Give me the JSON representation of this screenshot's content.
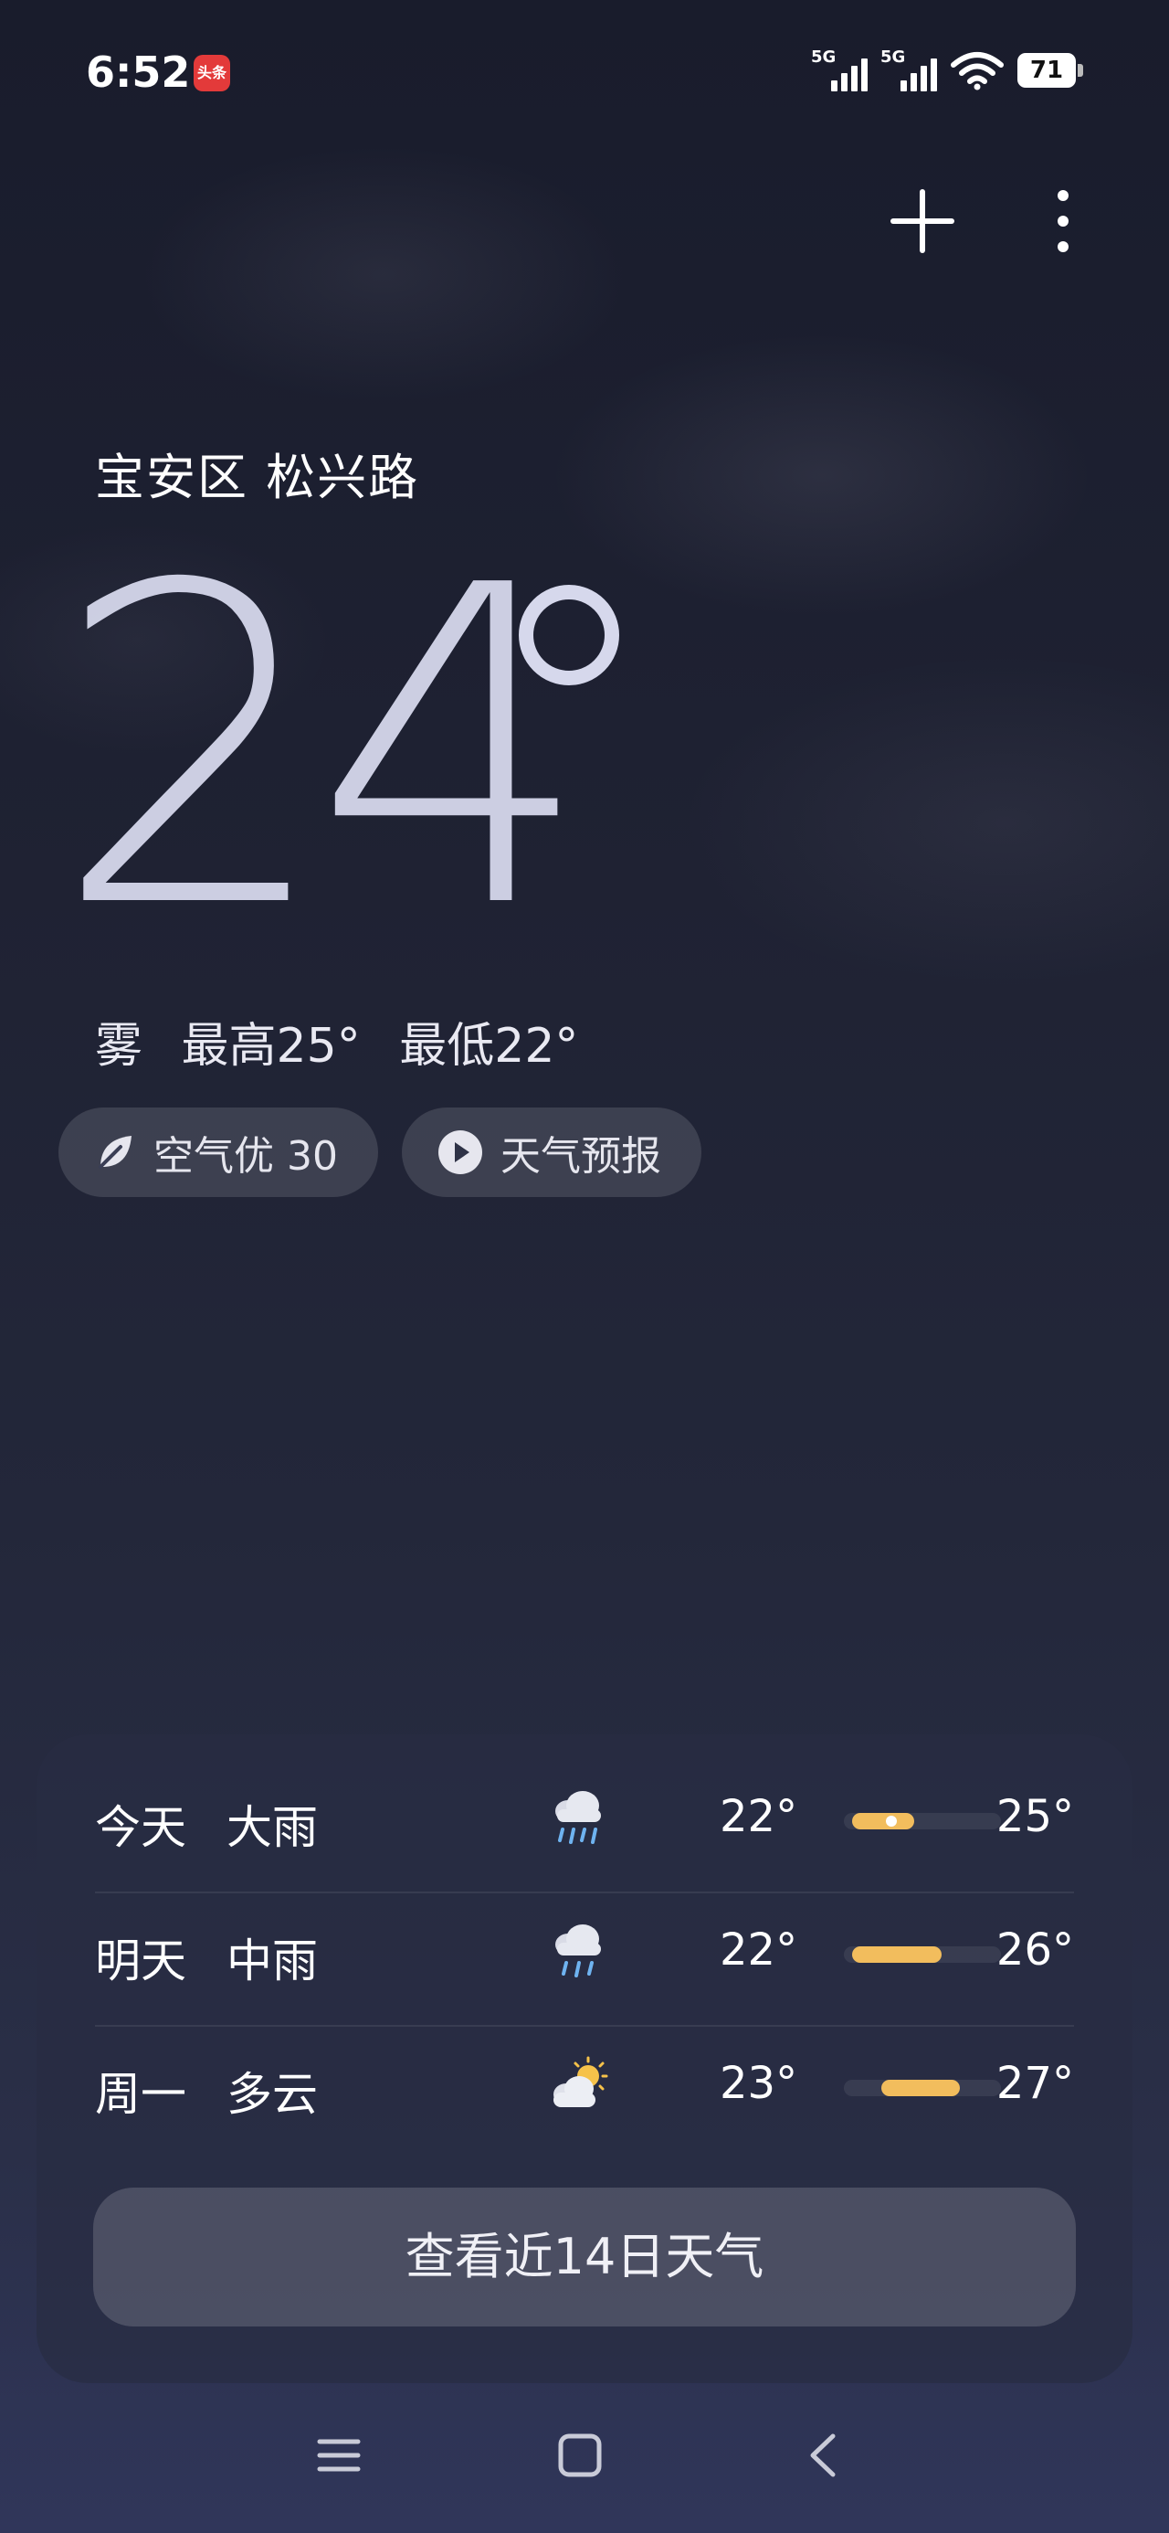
{
  "status_bar": {
    "time": "6:52",
    "app_badge": "头条",
    "signal_1_label": "5G",
    "signal_2_label": "5G",
    "battery": "71"
  },
  "location": "宝安区 松兴路",
  "current": {
    "temperature": "24",
    "condition": "雾",
    "high": "最高25°",
    "low": "最低22°"
  },
  "chips": {
    "air_quality": "空气优 30",
    "forecast_video": "天气预报"
  },
  "forecast": [
    {
      "day": "今天",
      "condition": "大雨",
      "icon": "heavy-rain-icon",
      "low": "22°",
      "high": "25°",
      "bar_start": 0.05,
      "bar_end": 0.45,
      "current_marker": 0.3
    },
    {
      "day": "明天",
      "condition": "中雨",
      "icon": "moderate-rain-icon",
      "low": "22°",
      "high": "26°",
      "bar_start": 0.05,
      "bar_end": 0.62,
      "current_marker": null
    },
    {
      "day": "周一",
      "condition": "多云",
      "icon": "partly-cloudy-icon",
      "low": "23°",
      "high": "27°",
      "bar_start": 0.24,
      "bar_end": 0.74,
      "current_marker": null
    }
  ],
  "view_14_days": "查看近14日天气",
  "colors": {
    "accent_bar": "#f2bd5d",
    "background_top": "#191c2c",
    "background_bottom": "#30365a"
  }
}
